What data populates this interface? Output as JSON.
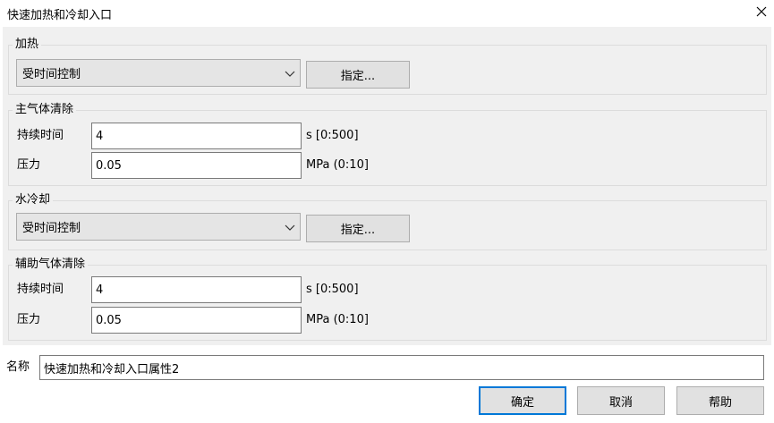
{
  "window": {
    "title": "快速加热和冷却入口",
    "close_glyph": "✕"
  },
  "heating": {
    "label": "加热",
    "mode_value": "受时间控制",
    "specify_label": "指定..."
  },
  "main_gas_purge": {
    "label": "主气体清除",
    "duration_label": "持续时间",
    "duration_value": "4",
    "duration_unit": "s [0:500]",
    "pressure_label": "压力",
    "pressure_value": "0.05",
    "pressure_unit": "MPa (0:10]"
  },
  "water_cooling": {
    "label": "水冷却",
    "mode_value": "受时间控制",
    "specify_label": "指定..."
  },
  "aux_gas_purge": {
    "label": "辅助气体清除",
    "duration_label": "持续时间",
    "duration_value": "4",
    "duration_unit": "s [0:500]",
    "pressure_label": "压力",
    "pressure_value": "0.05",
    "pressure_unit": "MPa (0:10]"
  },
  "name": {
    "label": "名称",
    "value": "快速加热和冷却入口属性2"
  },
  "footer": {
    "ok_label": "确定",
    "cancel_label": "取消",
    "help_label": "帮助"
  },
  "colors": {
    "accent": "#0078d7",
    "panel": "#f0f0f0"
  }
}
